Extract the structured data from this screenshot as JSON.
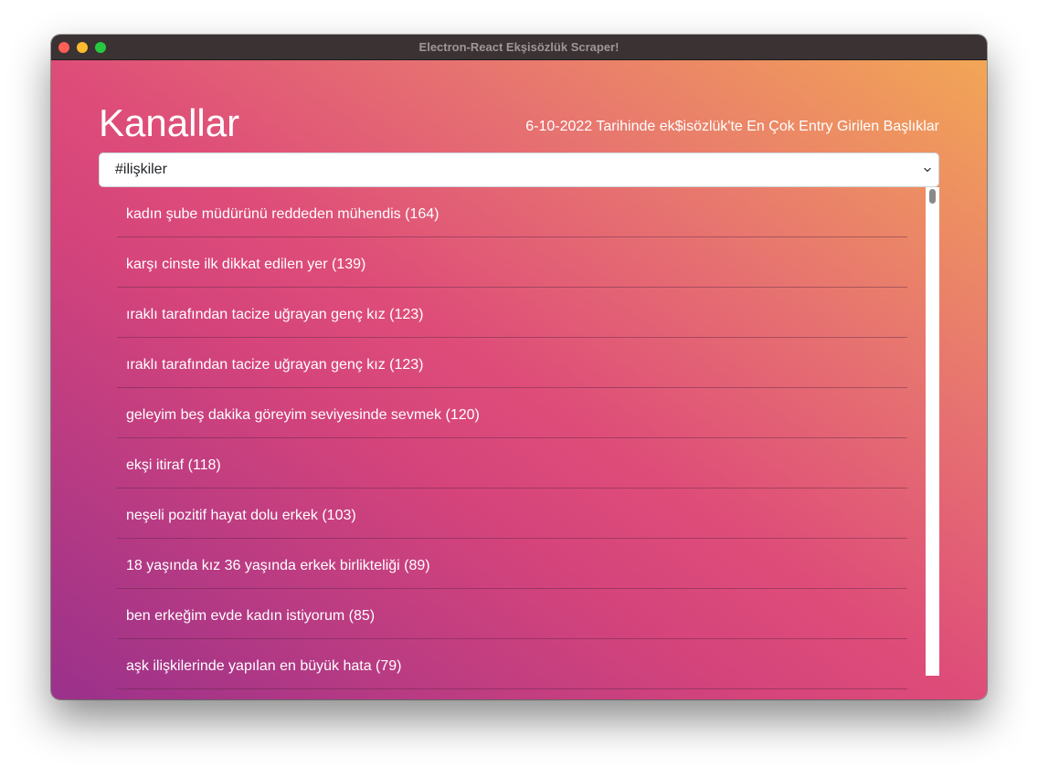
{
  "window": {
    "title": "Electron-React Ekşisözlük Scraper!"
  },
  "header": {
    "title": "Kanallar",
    "subtitle": "6-10-2022 Tarihinde ek$isözlük'te En Çok Entry Girilen Başlıklar"
  },
  "channel_select": {
    "selected": "#ilişkiler"
  },
  "topics": [
    "kadın şube müdürünü reddeden mühendis (164)",
    "karşı cinste ilk dikkat edilen yer (139)",
    "ıraklı tarafından tacize uğrayan genç kız (123)",
    "ıraklı tarafından tacize uğrayan genç kız (123)",
    "geleyim beş dakika göreyim seviyesinde sevmek (120)",
    "ekşi itiraf (118)",
    "neşeli pozitif hayat dolu erkek (103)",
    "18 yaşında kız 36 yaşında erkek birlikteliği (89)",
    "ben erkeğim evde kadın istiyorum (85)",
    "aşk ilişkilerinde yapılan en büyük hata (79)"
  ],
  "colors": {
    "titlebar": "#3a3233",
    "gradient_start": "#9a318b",
    "gradient_mid": "#de4d79",
    "gradient_end": "#f2a656"
  }
}
